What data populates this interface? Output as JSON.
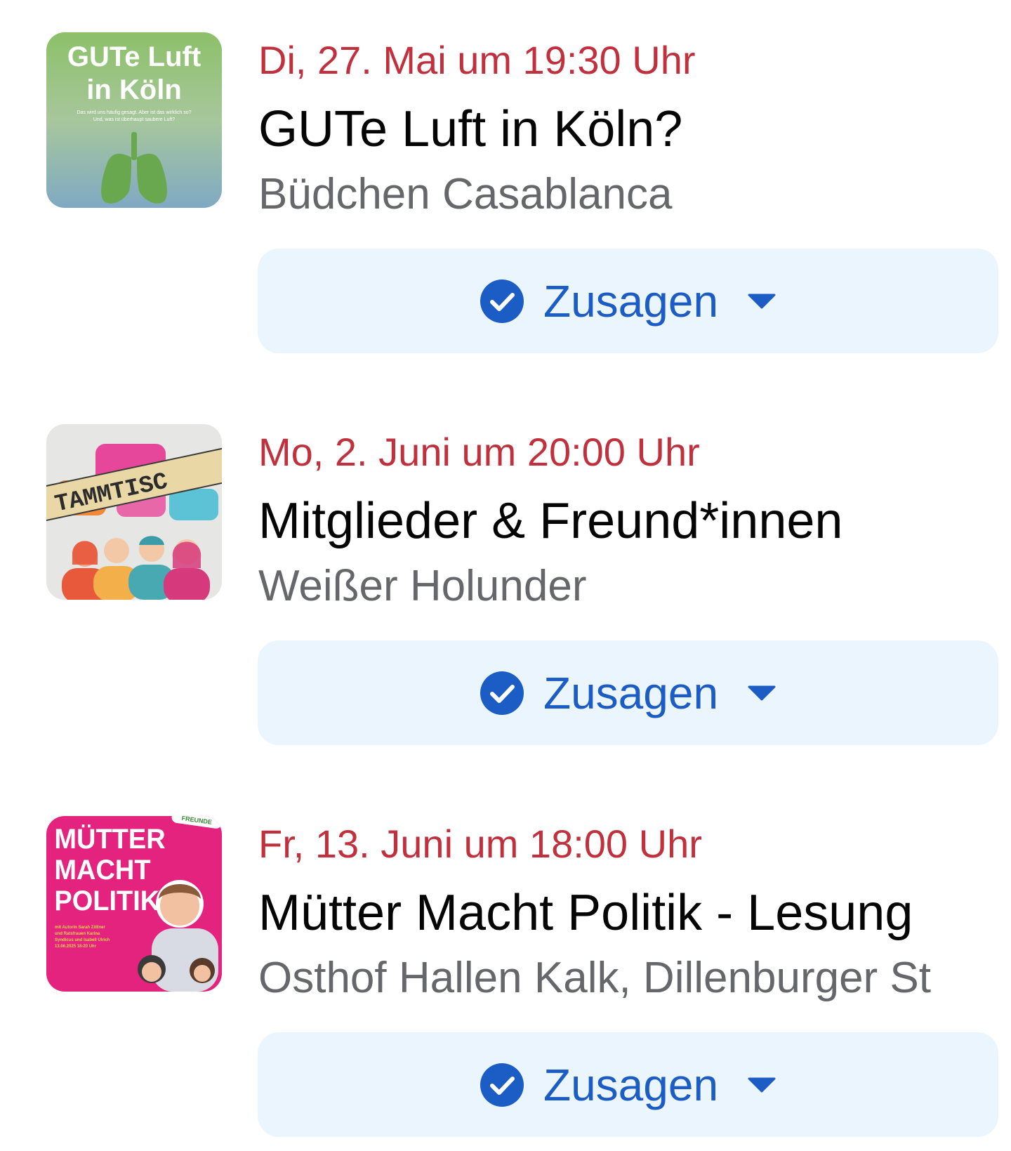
{
  "events": [
    {
      "date": "Di, 27. Mai um 19:30 Uhr",
      "title": "GUTe Luft in Köln?",
      "location": "Büdchen Casablanca",
      "rsvp_label": "Zusagen",
      "thumb": {
        "line1": "GUTe Luft",
        "line2": "in Köln",
        "small1": "Das wird uns häufig gesagt. Aber ist das wirklich so?",
        "small2": "Und, was ist überhaupt saubere Luft?",
        "icon": "lungs-icon"
      }
    },
    {
      "date": "Mo, 2. Juni um 20:00 Uhr",
      "title": "Mitglieder & Freund*innen",
      "location": "Weißer Holunder",
      "rsvp_label": "Zusagen",
      "thumb": {
        "banner": "TAMMTISC",
        "icon": "people-icon"
      }
    },
    {
      "date": "Fr, 13. Juni um 18:00 Uhr",
      "title": "Mütter Macht Politik - Lesung",
      "location": "Osthof Hallen Kalk, Dillenburger St",
      "rsvp_label": "Zusagen",
      "thumb": {
        "line1": "MÜTTER",
        "line2": "MACHT",
        "line3": "POLITIK",
        "small1": "mit Autorin Sarah Zöllner",
        "small2": "und Ratsfrauen Karina",
        "small3": "Syndicus und Isabell Ulrich",
        "small4": "13.06.2025 18-20 Uhr",
        "badge": "FREUNDE"
      }
    }
  ],
  "colors": {
    "date": "#c0313d",
    "title": "#050505",
    "location": "#65676b",
    "rsvp_bg": "#ebf5fe",
    "rsvp_text": "#1b5cc5"
  }
}
